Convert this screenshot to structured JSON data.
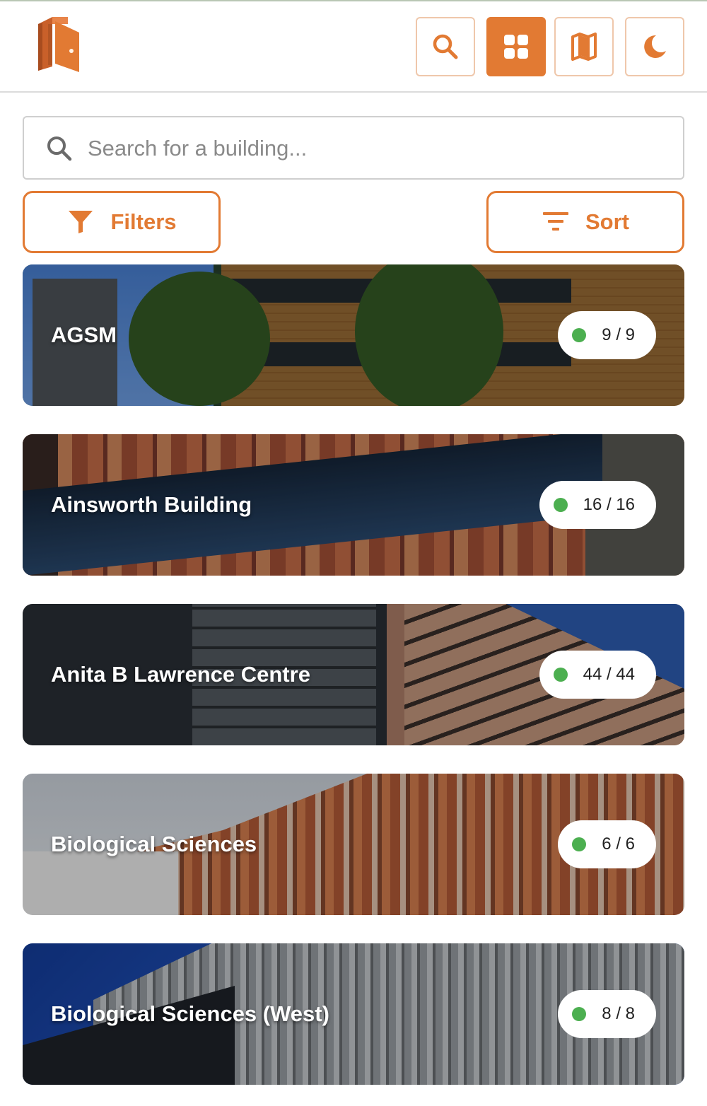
{
  "header": {
    "logo_icon": "door-logo-icon",
    "buttons": [
      {
        "name": "search-view",
        "icon": "search-icon",
        "active": false
      },
      {
        "name": "grid-view",
        "icon": "grid-icon",
        "active": true
      },
      {
        "name": "map-view",
        "icon": "map-icon",
        "active": false
      },
      {
        "name": "dark-mode",
        "icon": "moon-icon",
        "active": false
      }
    ]
  },
  "search": {
    "placeholder": "Search for a building...",
    "value": ""
  },
  "controls": {
    "filters_label": "Filters",
    "sort_label": "Sort"
  },
  "colors": {
    "accent": "#e27a33",
    "available_dot": "#4caf50"
  },
  "buildings": [
    {
      "name": "AGSM",
      "rooms": "9 / 9"
    },
    {
      "name": "Ainsworth Building",
      "rooms": "16 / 16"
    },
    {
      "name": "Anita B Lawrence Centre",
      "rooms": "44 / 44"
    },
    {
      "name": "Biological Sciences",
      "rooms": "6 / 6"
    },
    {
      "name": "Biological Sciences (West)",
      "rooms": "8 / 8"
    }
  ]
}
